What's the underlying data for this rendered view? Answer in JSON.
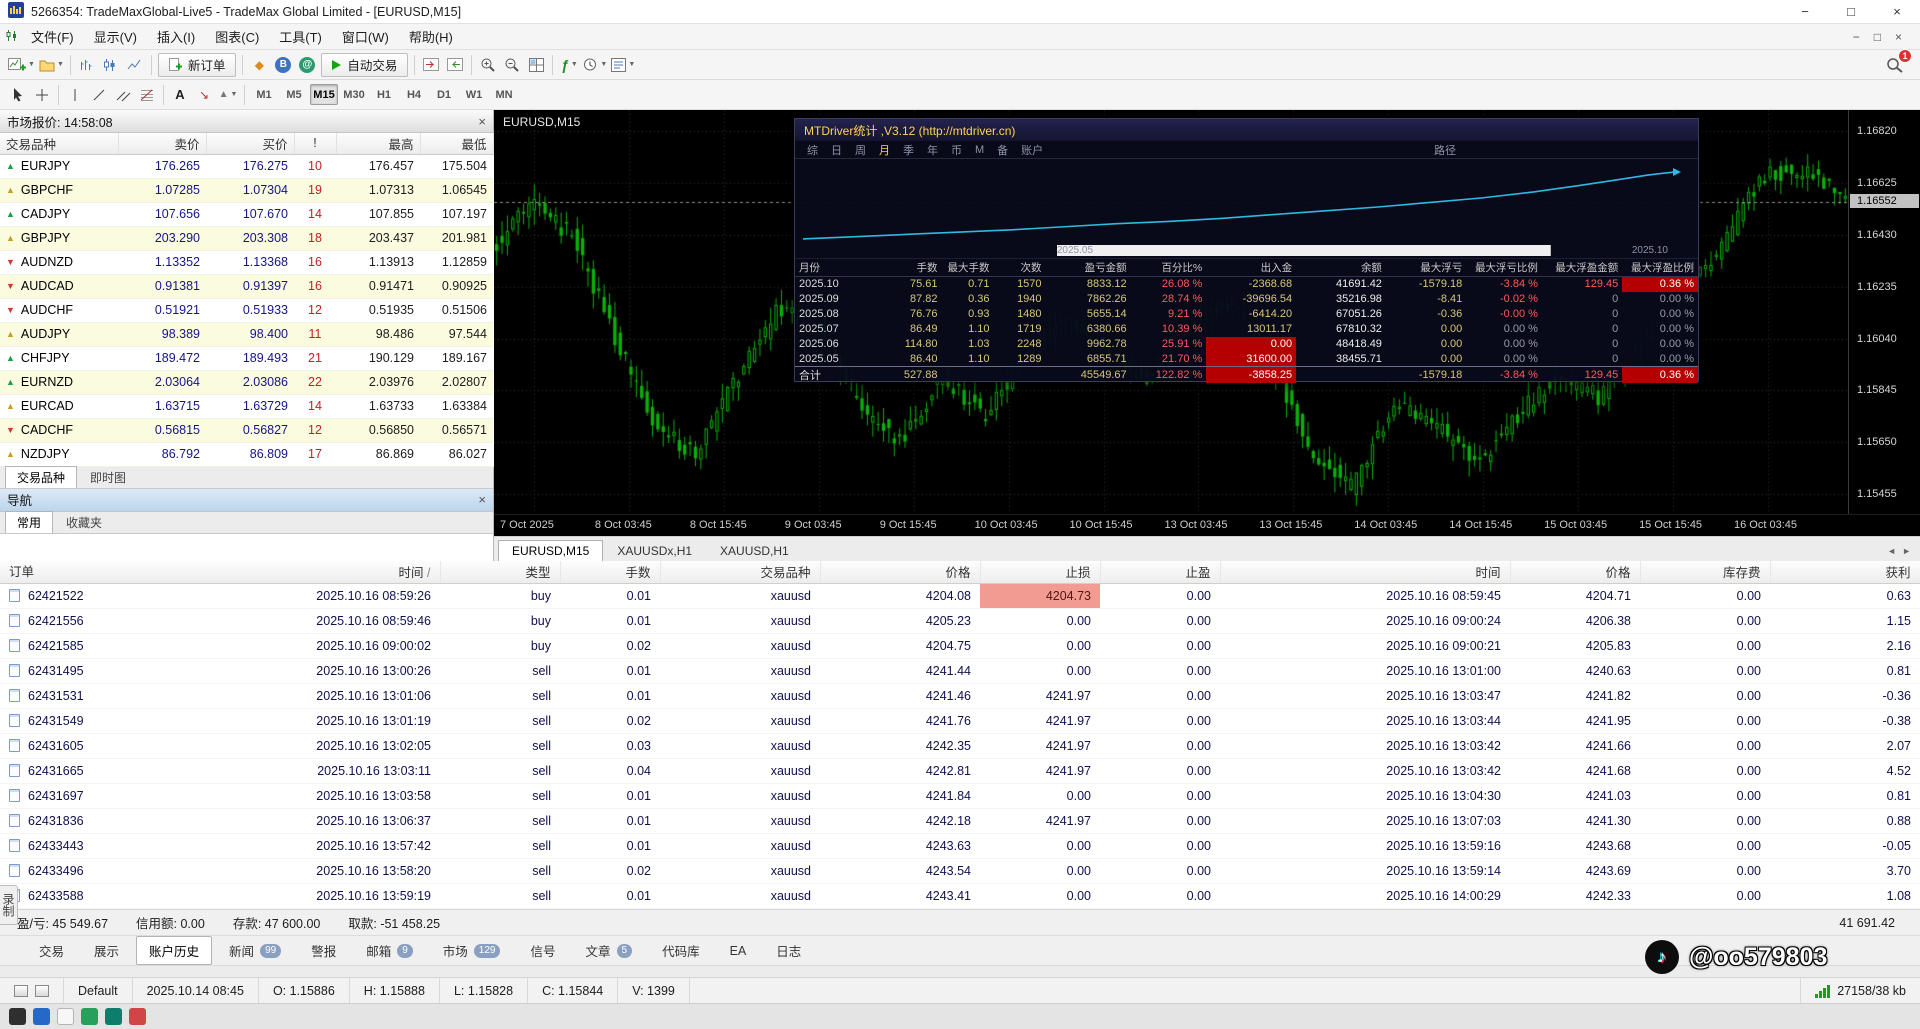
{
  "titlebar": {
    "title": "5266354: TradeMaxGlobal-Live5 - TradeMax Global Limited - [EURUSD,M15]",
    "minimize": "−",
    "maximize": "□",
    "close": "×"
  },
  "menubar": {
    "items": [
      "文件(F)",
      "显示(V)",
      "插入(I)",
      "图表(C)",
      "工具(T)",
      "窗口(W)",
      "帮助(H)"
    ],
    "mdi_minimize": "−",
    "mdi_restore": "□",
    "mdi_close": "×"
  },
  "toolbar1": {
    "new_order_label": "新订单",
    "auto_trading_label": "自动交易",
    "notification_count": "1"
  },
  "toolbar2": {
    "text_tool": "A",
    "timeframes": [
      "M1",
      "M5",
      "M15",
      "M30",
      "H1",
      "H4",
      "D1",
      "W1",
      "MN"
    ],
    "active_timeframe": "M15"
  },
  "market_watch": {
    "title": "市场报价: 14:58:08",
    "columns": [
      "交易品种",
      "卖价",
      "买价",
      "!",
      "最高",
      "最低"
    ],
    "rows": [
      {
        "symbol": "EURJPY",
        "dir": "up",
        "color": "#1f9c46",
        "sell": "176.265",
        "buy": "176.275",
        "spread": "10",
        "high": "176.457",
        "low": "175.504"
      },
      {
        "symbol": "GBPCHF",
        "dir": "up",
        "color": "#c79b2a",
        "sell": "1.07285",
        "buy": "1.07304",
        "spread": "19",
        "high": "1.07313",
        "low": "1.06545"
      },
      {
        "symbol": "CADJPY",
        "dir": "up",
        "color": "#1f9c46",
        "sell": "107.656",
        "buy": "107.670",
        "spread": "14",
        "high": "107.855",
        "low": "107.197"
      },
      {
        "symbol": "GBPJPY",
        "dir": "up",
        "color": "#c79b2a",
        "sell": "203.290",
        "buy": "203.308",
        "spread": "18",
        "high": "203.437",
        "low": "201.981"
      },
      {
        "symbol": "AUDNZD",
        "dir": "down",
        "color": "#cc3b30",
        "sell": "1.13352",
        "buy": "1.13368",
        "spread": "16",
        "high": "1.13913",
        "low": "1.12859"
      },
      {
        "symbol": "AUDCAD",
        "dir": "down",
        "color": "#cc3b30",
        "sell": "0.91381",
        "buy": "0.91397",
        "spread": "16",
        "high": "0.91471",
        "low": "0.90925"
      },
      {
        "symbol": "AUDCHF",
        "dir": "down",
        "color": "#cc3b30",
        "sell": "0.51921",
        "buy": "0.51933",
        "spread": "12",
        "high": "0.51935",
        "low": "0.51506"
      },
      {
        "symbol": "AUDJPY",
        "dir": "up",
        "color": "#c79b2a",
        "sell": "98.389",
        "buy": "98.400",
        "spread": "11",
        "high": "98.486",
        "low": "97.544"
      },
      {
        "symbol": "CHFJPY",
        "dir": "up",
        "color": "#1f9c46",
        "sell": "189.472",
        "buy": "189.493",
        "spread": "21",
        "high": "190.129",
        "low": "189.167"
      },
      {
        "symbol": "EURNZD",
        "dir": "up",
        "color": "#1f9c46",
        "sell": "2.03064",
        "buy": "2.03086",
        "spread": "22",
        "high": "2.03976",
        "low": "2.02807"
      },
      {
        "symbol": "EURCAD",
        "dir": "up",
        "color": "#c79b2a",
        "sell": "1.63715",
        "buy": "1.63729",
        "spread": "14",
        "high": "1.63733",
        "low": "1.63384"
      },
      {
        "symbol": "CADCHF",
        "dir": "down",
        "color": "#cc3b30",
        "sell": "0.56815",
        "buy": "0.56827",
        "spread": "12",
        "high": "0.56850",
        "low": "0.56571"
      },
      {
        "symbol": "NZDJPY",
        "dir": "up",
        "color": "#c79b2a",
        "sell": "86.792",
        "buy": "86.809",
        "spread": "17",
        "high": "86.869",
        "low": "86.027"
      }
    ],
    "tabs": [
      "交易品种",
      "即时图"
    ],
    "active_tab": "交易品种"
  },
  "navigator": {
    "title": "导航",
    "tabs": [
      "常用",
      "收藏夹"
    ],
    "active_tab": "常用"
  },
  "chart": {
    "symbol_label": "EURUSD,M15",
    "scale_min": 1.1538,
    "scale_max": 1.169,
    "current_price": "1.16552",
    "y_labels": [
      "1.16820",
      "1.16625",
      "1.16430",
      "1.16235",
      "1.16040",
      "1.15845",
      "1.15650",
      "1.15455"
    ],
    "x_labels": [
      "7 Oct 2025",
      "8 Oct 03:45",
      "8 Oct 15:45",
      "9 Oct 03:45",
      "9 Oct 15:45",
      "10 Oct 03:45",
      "10 Oct 15:45",
      "13 Oct 03:45",
      "13 Oct 15:45",
      "14 Oct 03:45",
      "14 Oct 15:45",
      "15 Oct 03:45",
      "15 Oct 15:45",
      "16 Oct 03:45"
    ],
    "keypoints": [
      1.1638,
      1.1655,
      1.1642,
      1.1605,
      1.1572,
      1.156,
      1.159,
      1.1615,
      1.161,
      1.1578,
      1.1565,
      1.159,
      1.1575,
      1.1598,
      1.1612,
      1.16,
      1.1588,
      1.161,
      1.1618,
      1.1595,
      1.156,
      1.1548,
      1.158,
      1.1572,
      1.1556,
      1.1575,
      1.159,
      1.1582,
      1.1602,
      1.1618,
      1.164,
      1.1665,
      1.1668,
      1.16552
    ],
    "candle_count": 252,
    "up_color": "#0bb00b",
    "grid_color": "#1c3a1c"
  },
  "chart_tabs": {
    "tabs": [
      "EURUSD,M15",
      "XAUUSDx,H1",
      "XAUUSD,H1"
    ],
    "active_index": 0
  },
  "mtdriver": {
    "title": "MTDriver统计 ,V3.12 (http://mtdriver.cn)",
    "tabs": [
      "综",
      "日",
      "周",
      "月",
      "季",
      "年",
      "币",
      "M",
      "备",
      "账户"
    ],
    "active_tab": "月",
    "path_label": "路径",
    "axis_left": "2025.05",
    "axis_right": "2025.10",
    "curve": [
      [
        0,
        8
      ],
      [
        6,
        11
      ],
      [
        12,
        14
      ],
      [
        18,
        17
      ],
      [
        24,
        20
      ],
      [
        30,
        24
      ],
      [
        36,
        28
      ],
      [
        42,
        31
      ],
      [
        48,
        35
      ],
      [
        54,
        40
      ],
      [
        60,
        45
      ],
      [
        66,
        50
      ],
      [
        72,
        56
      ],
      [
        78,
        62
      ],
      [
        84,
        70
      ],
      [
        89,
        78
      ],
      [
        93,
        85
      ],
      [
        97,
        92
      ],
      [
        100,
        96
      ]
    ],
    "columns": [
      "月份",
      "手数",
      "最大手数",
      "次数",
      "盈亏金额",
      "百分比%",
      "出入金",
      "余额",
      "最大浮亏",
      "最大浮亏比例",
      "最大浮盈金额",
      "最大浮盈比例"
    ],
    "rows": [
      [
        "2025.10",
        "75.61",
        "0.71",
        "1570",
        "8833.12",
        "26.08 %",
        "-2368.68",
        "41691.42",
        "-1579.18",
        "-3.84 %",
        "129.45",
        "0.36 %"
      ],
      [
        "2025.09",
        "87.82",
        "0.36",
        "1940",
        "7862.26",
        "28.74 %",
        "-39696.54",
        "35216.98",
        "-8.41",
        "-0.02 %",
        "0",
        "0.00 %"
      ],
      [
        "2025.08",
        "76.76",
        "0.93",
        "1480",
        "5655.14",
        "9.21 %",
        "-6414.20",
        "67051.26",
        "-0.36",
        "-0.00 %",
        "0",
        "0.00 %"
      ],
      [
        "2025.07",
        "86.49",
        "1.10",
        "1719",
        "6380.66",
        "10.39 %",
        "13011.17",
        "67810.32",
        "0.00",
        "0.00 %",
        "0",
        "0.00 %"
      ],
      [
        "2025.06",
        "114.80",
        "1.03",
        "2248",
        "9962.78",
        "25.91 %",
        "0.00",
        "48418.49",
        "0.00",
        "0.00 %",
        "0",
        "0.00 %"
      ],
      [
        "2025.05",
        "86.40",
        "1.10",
        "1289",
        "6855.71",
        "21.70 %",
        "31600.00",
        "38455.71",
        "0.00",
        "0.00 %",
        "0",
        "0.00 %"
      ],
      [
        "合计",
        "527.88",
        "",
        "",
        "45549.67",
        "122.82 %",
        "-3858.25",
        "",
        "-1579.18",
        "-3.84 %",
        "129.45",
        "0.36 %"
      ]
    ],
    "red_bg_cells": [
      [
        0,
        11
      ],
      [
        4,
        6
      ],
      [
        5,
        6
      ],
      [
        6,
        6
      ],
      [
        6,
        11
      ]
    ]
  },
  "orders": {
    "columns": [
      "订单",
      "时间",
      "类型",
      "手数",
      "交易品种",
      "价格",
      "止损",
      "止盈",
      "时间",
      "价格",
      "库存费",
      "获利"
    ],
    "sort_column_index": 1,
    "sort_glyph": "/",
    "rows": [
      {
        "id": "62421522",
        "open_time": "2025.10.16 08:59:26",
        "type": "buy",
        "lots": "0.01",
        "symbol": "xauusd",
        "open_price": "4204.08",
        "sl": "4204.73",
        "sl_hit": true,
        "tp": "0.00",
        "close_time": "2025.10.16 08:59:45",
        "close_price": "4204.71",
        "swap": "0.00",
        "profit": "0.63"
      },
      {
        "id": "62421556",
        "open_time": "2025.10.16 08:59:46",
        "type": "buy",
        "lots": "0.01",
        "symbol": "xauusd",
        "open_price": "4205.23",
        "sl": "0.00",
        "tp": "0.00",
        "close_time": "2025.10.16 09:00:24",
        "close_price": "4206.38",
        "swap": "0.00",
        "profit": "1.15"
      },
      {
        "id": "62421585",
        "open_time": "2025.10.16 09:00:02",
        "type": "buy",
        "lots": "0.02",
        "symbol": "xauusd",
        "open_price": "4204.75",
        "sl": "0.00",
        "tp": "0.00",
        "close_time": "2025.10.16 09:00:21",
        "close_price": "4205.83",
        "swap": "0.00",
        "profit": "2.16"
      },
      {
        "id": "62431495",
        "open_time": "2025.10.16 13:00:26",
        "type": "sell",
        "lots": "0.01",
        "symbol": "xauusd",
        "open_price": "4241.44",
        "sl": "0.00",
        "tp": "0.00",
        "close_time": "2025.10.16 13:01:00",
        "close_price": "4240.63",
        "swap": "0.00",
        "profit": "0.81"
      },
      {
        "id": "62431531",
        "open_time": "2025.10.16 13:01:06",
        "type": "sell",
        "lots": "0.01",
        "symbol": "xauusd",
        "open_price": "4241.46",
        "sl": "4241.97",
        "tp": "0.00",
        "close_time": "2025.10.16 13:03:47",
        "close_price": "4241.82",
        "swap": "0.00",
        "profit": "-0.36"
      },
      {
        "id": "62431549",
        "open_time": "2025.10.16 13:01:19",
        "type": "sell",
        "lots": "0.02",
        "symbol": "xauusd",
        "open_price": "4241.76",
        "sl": "4241.97",
        "tp": "0.00",
        "close_time": "2025.10.16 13:03:44",
        "close_price": "4241.95",
        "swap": "0.00",
        "profit": "-0.38"
      },
      {
        "id": "62431605",
        "open_time": "2025.10.16 13:02:05",
        "type": "sell",
        "lots": "0.03",
        "symbol": "xauusd",
        "open_price": "4242.35",
        "sl": "4241.97",
        "tp": "0.00",
        "close_time": "2025.10.16 13:03:42",
        "close_price": "4241.66",
        "swap": "0.00",
        "profit": "2.07"
      },
      {
        "id": "62431665",
        "open_time": "2025.10.16 13:03:11",
        "type": "sell",
        "lots": "0.04",
        "symbol": "xauusd",
        "open_price": "4242.81",
        "sl": "4241.97",
        "tp": "0.00",
        "close_time": "2025.10.16 13:03:42",
        "close_price": "4241.68",
        "swap": "0.00",
        "profit": "4.52"
      },
      {
        "id": "62431697",
        "open_time": "2025.10.16 13:03:58",
        "type": "sell",
        "lots": "0.01",
        "symbol": "xauusd",
        "open_price": "4241.84",
        "sl": "0.00",
        "tp": "0.00",
        "close_time": "2025.10.16 13:04:30",
        "close_price": "4241.03",
        "swap": "0.00",
        "profit": "0.81"
      },
      {
        "id": "62431836",
        "open_time": "2025.10.16 13:06:37",
        "type": "sell",
        "lots": "0.01",
        "symbol": "xauusd",
        "open_price": "4242.18",
        "sl": "4241.97",
        "tp": "0.00",
        "close_time": "2025.10.16 13:07:03",
        "close_price": "4241.30",
        "swap": "0.00",
        "profit": "0.88"
      },
      {
        "id": "62433443",
        "open_time": "2025.10.16 13:57:42",
        "type": "sell",
        "lots": "0.01",
        "symbol": "xauusd",
        "open_price": "4243.63",
        "sl": "0.00",
        "tp": "0.00",
        "close_time": "2025.10.16 13:59:16",
        "close_price": "4243.68",
        "swap": "0.00",
        "profit": "-0.05"
      },
      {
        "id": "62433496",
        "open_time": "2025.10.16 13:58:20",
        "type": "sell",
        "lots": "0.02",
        "symbol": "xauusd",
        "open_price": "4243.54",
        "sl": "0.00",
        "tp": "0.00",
        "close_time": "2025.10.16 13:59:14",
        "close_price": "4243.69",
        "swap": "0.00",
        "profit": "3.70"
      },
      {
        "id": "62433588",
        "open_time": "2025.10.16 13:59:19",
        "type": "sell",
        "lots": "0.01",
        "symbol": "xauusd",
        "open_price": "4243.41",
        "sl": "0.00",
        "tp": "0.00",
        "close_time": "2025.10.16 14:00:29",
        "close_price": "4242.33",
        "swap": "0.00",
        "profit": "1.08"
      }
    ],
    "summary": {
      "segments": [
        "盈/亏: 45 549.67",
        "信用额: 0.00",
        "存款: 47 600.00",
        "取款: -51 458.25"
      ],
      "balance": "41 691.42"
    }
  },
  "bottom_tabs": [
    {
      "label": "交易"
    },
    {
      "label": "展示"
    },
    {
      "label": "账户历史",
      "active": true
    },
    {
      "label": "新闻",
      "badge": "99"
    },
    {
      "label": "警报"
    },
    {
      "label": "邮箱",
      "badge": "9"
    },
    {
      "label": "市场",
      "badge": "129"
    },
    {
      "label": "信号"
    },
    {
      "label": "文章",
      "badge": "5"
    },
    {
      "label": "代码库"
    },
    {
      "label": "EA"
    },
    {
      "label": "日志"
    }
  ],
  "status_bar": {
    "profile": "Default",
    "datetime": "2025.10.14 08:45",
    "fields": [
      "O: 1.15886",
      "H: 1.15888",
      "L: 1.15828",
      "C: 1.15844",
      "V: 1399"
    ],
    "traffic": "27158/38 kb"
  },
  "watermark": {
    "handle": "@oo579803",
    "icon": "♪"
  },
  "side_widget": {
    "label": "录制"
  }
}
